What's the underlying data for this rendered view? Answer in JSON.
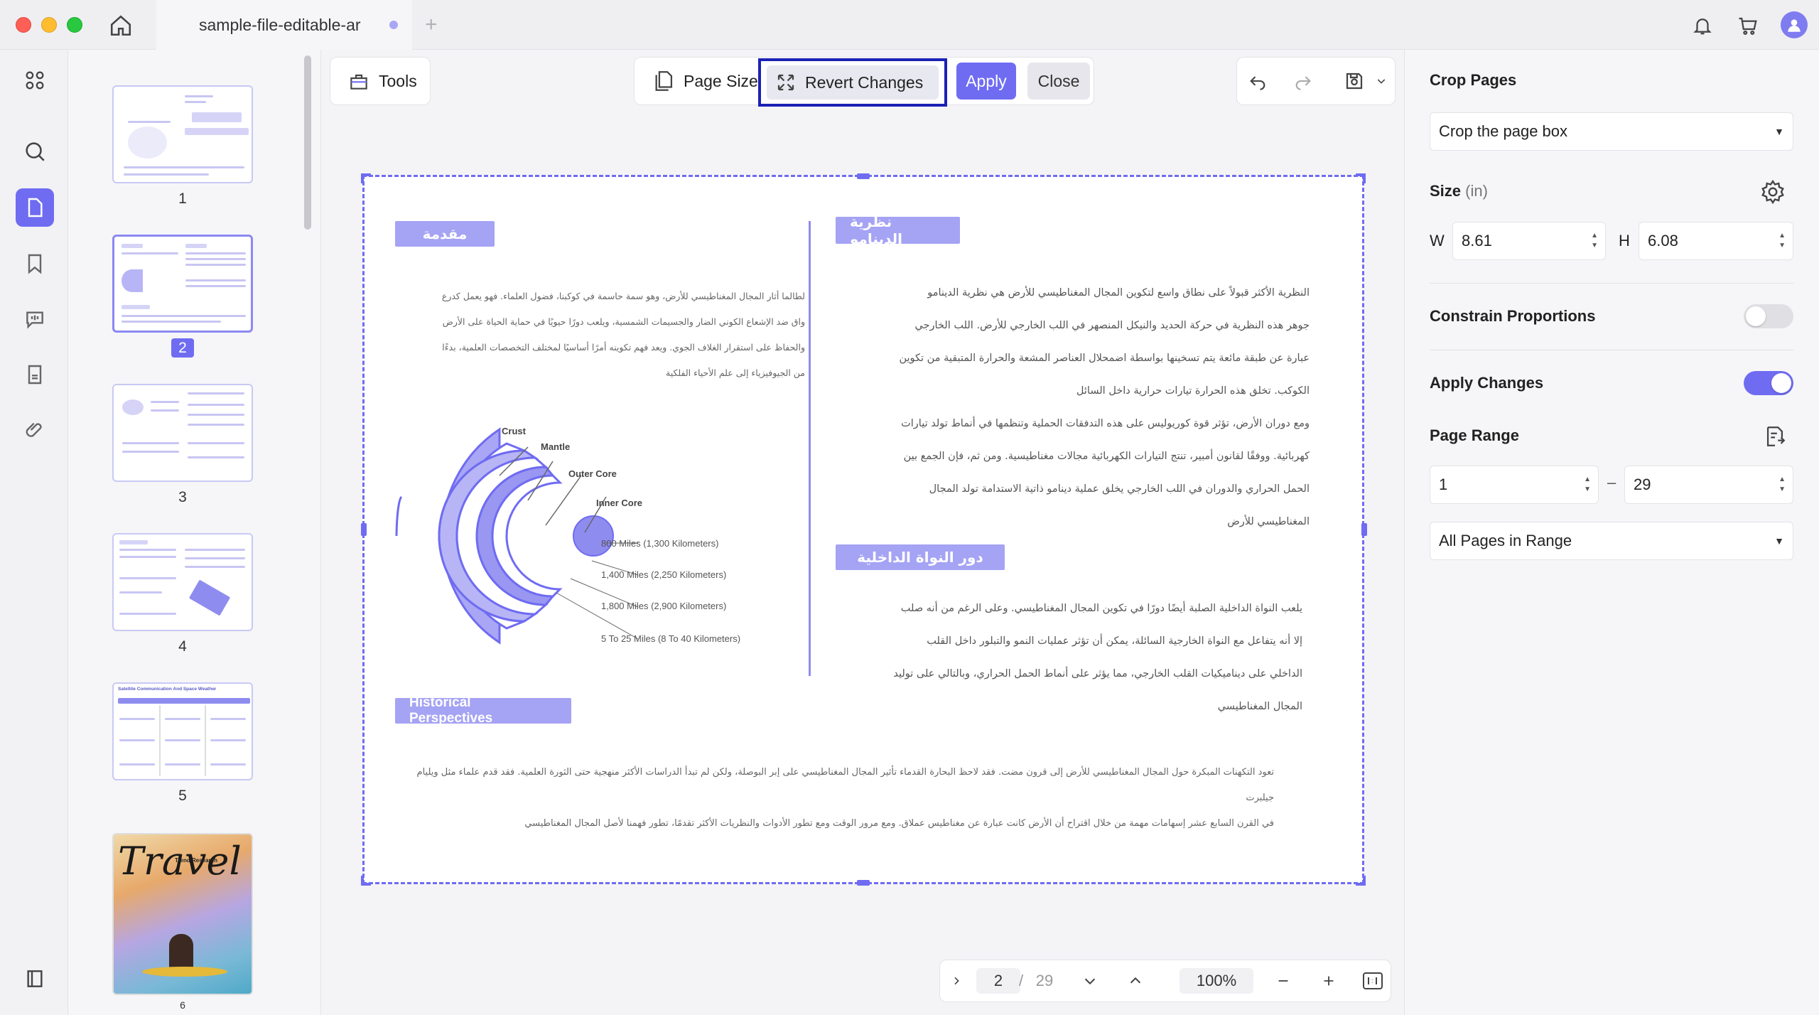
{
  "window": {
    "tab_title": "sample-file-editable-ar"
  },
  "toolbar": {
    "tools_label": "Tools",
    "page_size_label": "Page Size",
    "revert_label": "Revert Changes",
    "apply_label": "Apply",
    "close_label": "Close"
  },
  "thumbnails": [
    {
      "number": "1"
    },
    {
      "number": "2",
      "selected": true
    },
    {
      "number": "3"
    },
    {
      "number": "4"
    },
    {
      "number": "5"
    },
    {
      "number": "6"
    }
  ],
  "thumb5_title": "Satellite Communication And Space Weather",
  "thumb6": {
    "title": "Travel",
    "subtitle": "Trend Research"
  },
  "document": {
    "section1_title": "مقدمة",
    "section1_text": [
      "لطالما أثار المجال المغناطيسي للأرض، وهو سمة حاسمة في كوكبنا، فضول العلماء. فهو يعمل كدرع",
      "واق ضد الإشعاع الكوني الضار والجسيمات الشمسية، ويلعب دورًا حيويًا في حماية الحياة على الأرض",
      "والحفاظ على استقرار الغلاف الجوي. ويعد فهم تكوينه أمرًا أساسيًا لمختلف التخصصات العلمية، بدءًا",
      "من الجيوفيزياء إلى علم الأحياء الفلكية"
    ],
    "section2_title": "نظرية الدينامو",
    "section2_text": [
      "النظرية الأكثر قبولاً على نطاق واسع لتكوين المجال المغناطيسي للأرض هي نظرية الدينامو",
      "جوهر هذه النظرية في حركة الحديد والنيكل المنصهر في اللب الخارجي للأرض. اللب الخارجي",
      "عبارة عن طبقة مائعة يتم تسخينها بواسطة اضمحلال العناصر المشعة والحرارة المتبقية من تكوين",
      "الكوكب. تخلق هذه الحرارة تيارات حرارية داخل السائل",
      "ومع دوران الأرض، تؤثر قوة كوريوليس على هذه التدفقات الحملية وتنظمها في أنماط تولد تيارات",
      "كهربائية. ووفقًا لقانون أمبير، تنتج التيارات الكهربائية مجالات مغناطيسية. ومن ثم، فإن الجمع بين",
      "الحمل الحراري والدوران في اللب الخارجي يخلق عملية دينامو ذاتية الاستدامة تولد المجال",
      "المغناطيسي للأرض"
    ],
    "section3_title": "دور النواة الداخلية",
    "section3_text": [
      "يلعب النواة الداخلية الصلبة أيضًا دورًا في تكوين المجال المغناطيسي. وعلى الرغم من أنه صلب",
      "إلا أنه يتفاعل مع النواة الخارجية السائلة، يمكن أن تؤثر عمليات النمو والتبلور داخل القلب",
      "الداخلي على ديناميكيات القلب الخارجي، مما يؤثر على أنماط الحمل الحراري، وبالتالي على توليد",
      "المجال المغناطيسي"
    ],
    "section4_title": "Historical Perspectives",
    "section4_text": [
      "تعود التكهنات المبكرة حول المجال المغناطيسي للأرض إلى قرون مضت. فقد لاحظ البحارة القدماء تأثير المجال المغناطيسي على إبر البوصلة، ولكن لم تبدأ الدراسات الأكثر منهجية حتى الثورة العلمية. فقد قدم علماء مثل ويليام جيلبرت",
      "في القرن السابع عشر إسهامات مهمة من خلال اقتراح أن الأرض كانت عبارة عن مغناطيس عملاق. ومع مرور الوقت ومع تطور الأدوات والنظريات الأكثر تقدمًا، تطور فهمنا لأصل المجال المغناطيسي"
    ],
    "diagram": {
      "labels": [
        "Crust",
        "Mantle",
        "Outer Core",
        "Inner Core"
      ],
      "distances": [
        "800 Miles (1,300 Kilometers)",
        "1,400 Miles (2,250 Kilometers)",
        "1,800 Miles (2,900 Kilometers)",
        "5 To 25 Miles (8 To 40 Kilometers)"
      ]
    }
  },
  "bottom_nav": {
    "current_page": "2",
    "separator": "/",
    "total_pages": "29",
    "zoom": "100%"
  },
  "right_panel": {
    "title": "Crop Pages",
    "crop_mode": "Crop the page box",
    "size_label": "Size",
    "size_unit": "(in)",
    "width_label": "W",
    "width_value": "8.61",
    "height_label": "H",
    "height_value": "6.08",
    "constrain_label": "Constrain Proportions",
    "constrain_on": false,
    "apply_changes_label": "Apply Changes",
    "apply_changes_on": true,
    "page_range_label": "Page Range",
    "range_from": "1",
    "range_dash": "–",
    "range_to": "29",
    "range_mode": "All Pages in Range"
  },
  "colors": {
    "accent": "#6f6cf2",
    "heading_bar": "#a5a3f4",
    "revert_outline": "#1c21b5"
  }
}
